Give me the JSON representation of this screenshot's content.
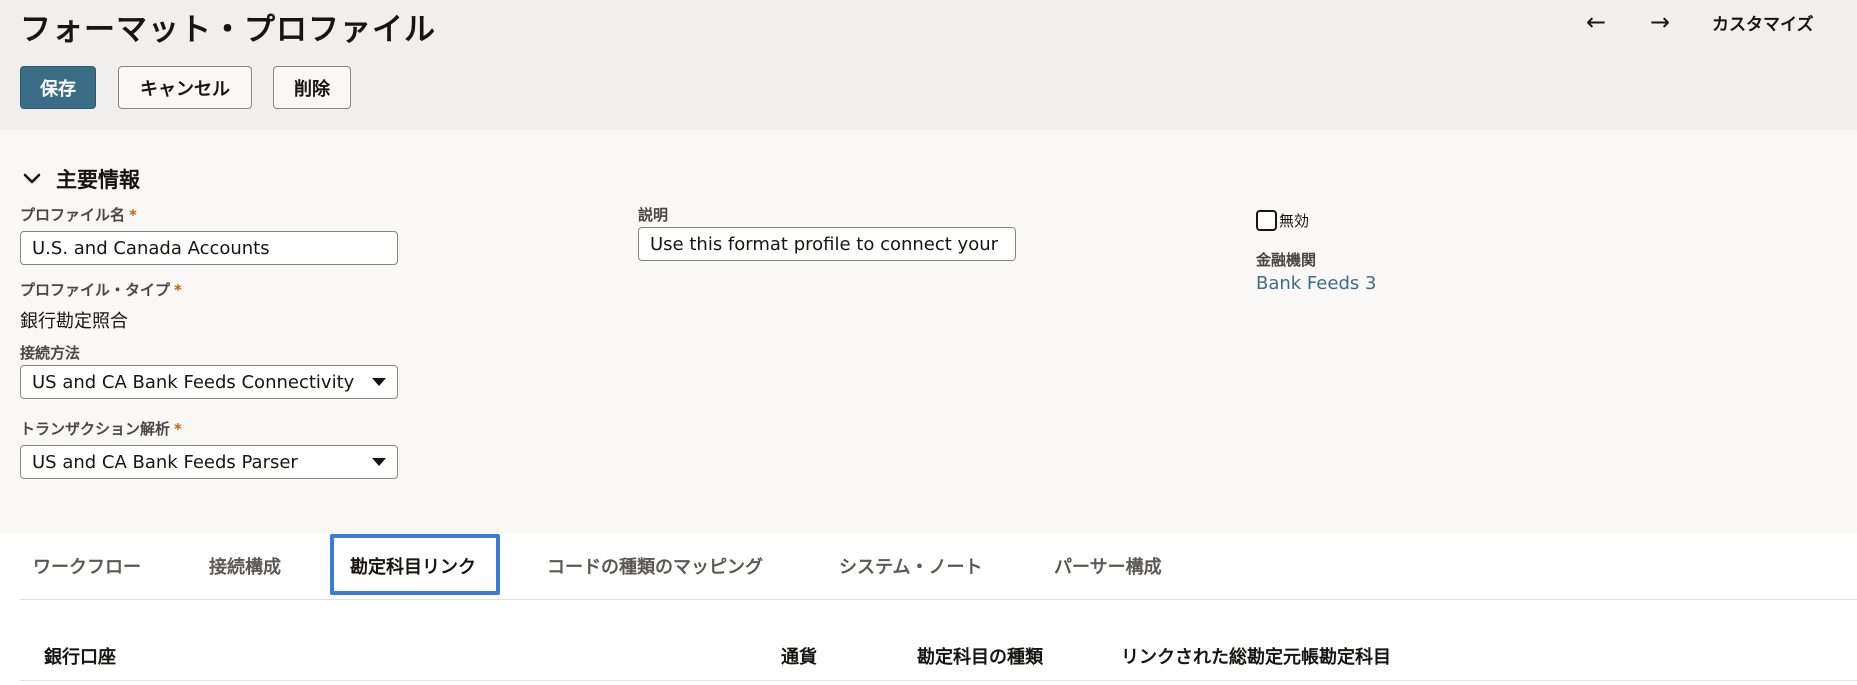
{
  "header": {
    "title": "フォーマット・プロファイル",
    "back_arrow": "←",
    "forward_arrow": "→",
    "customize": "カスタマイズ"
  },
  "toolbar": {
    "save_label": "保存",
    "cancel_label": "キャンセル",
    "delete_label": "削除"
  },
  "section": {
    "title": "主要情報"
  },
  "form": {
    "profile_name_label": "プロファイル名",
    "profile_name_value": "U.S. and Canada Accounts",
    "profile_type_label": "プロファイル・タイプ",
    "profile_type_value": "銀行勘定照合",
    "connection_method_label": "接続方法",
    "connection_method_value": "US and CA Bank Feeds Connectivity",
    "transaction_parser_label": "トランザクション解析",
    "transaction_parser_value": "US and CA Bank Feeds Parser",
    "description_label": "説明",
    "description_value": "Use this format profile to connect your …",
    "inactive_label": "無効",
    "inactive_checked": false,
    "financial_institution_label": "金融機関",
    "financial_institution_value": "Bank Feeds 3",
    "required_mark": "*"
  },
  "tabs": [
    {
      "label": "ワークフロー"
    },
    {
      "label": "接続構成"
    },
    {
      "label": "勘定科目リンク"
    },
    {
      "label": "コードの種類のマッピング"
    },
    {
      "label": "システム・ノート"
    },
    {
      "label": "パーサー構成"
    }
  ],
  "active_tab": 2,
  "table": {
    "columns": [
      "銀行口座",
      "通貨",
      "勘定科目の種類",
      "リンクされた総勘定元帳勘定科目"
    ]
  },
  "colors": {
    "accent": "#3b6e86",
    "required": "#c4650d",
    "focus": "#3b7bdc"
  }
}
